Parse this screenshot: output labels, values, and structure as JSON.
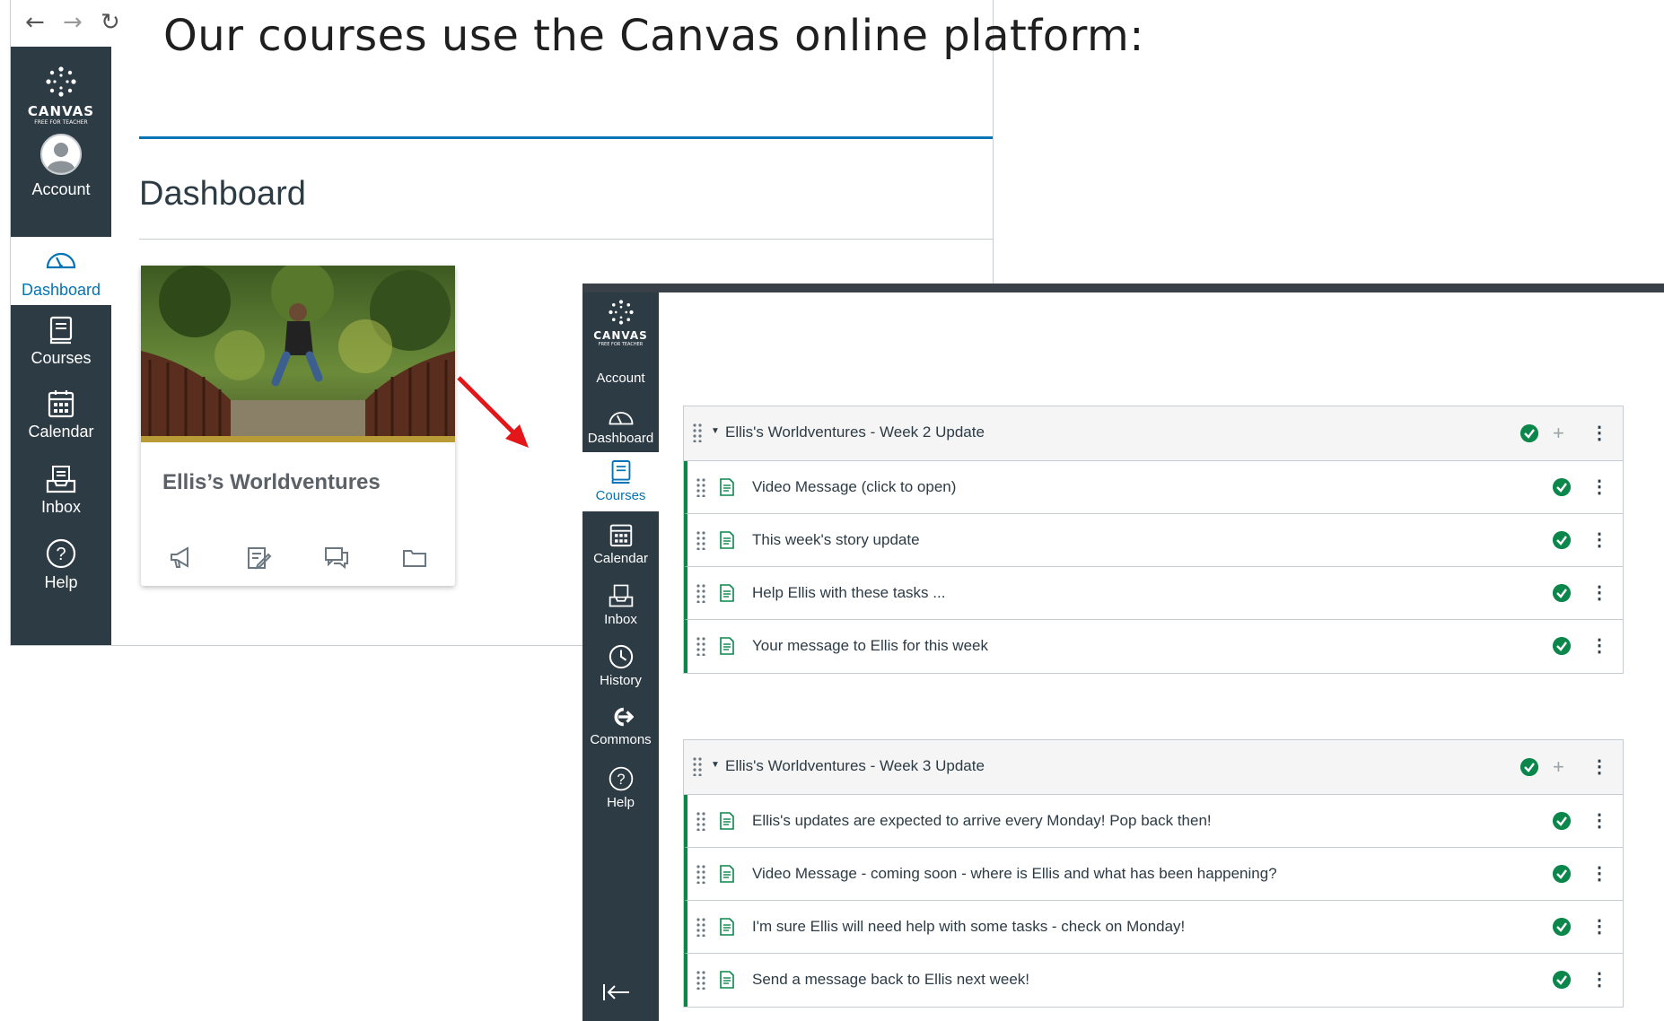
{
  "headline": "Our courses use the Canvas online platform:",
  "browser": {
    "back_icon": "←",
    "forward_icon": "→",
    "reload_icon": "↻"
  },
  "canvas_logo": {
    "text": "CANVAS",
    "sub": "FREE FOR TEACHER"
  },
  "left_nav": {
    "account": "Account",
    "dashboard": "Dashboard",
    "courses": "Courses",
    "calendar": "Calendar",
    "inbox": "Inbox",
    "help": "Help"
  },
  "dashboard": {
    "title": "Dashboard"
  },
  "course_card": {
    "title": "Ellis’s Worldventures"
  },
  "right_nav": {
    "account": "Account",
    "dashboard": "Dashboard",
    "courses": "Courses",
    "calendar": "Calendar",
    "inbox": "Inbox",
    "history": "History",
    "commons": "Commons",
    "help": "Help"
  },
  "modules": [
    {
      "title": "Ellis's Worldventures - Week 2 Update",
      "items": [
        "Video Message (click to open)",
        "This week's story update",
        "Help Ellis with these tasks ...",
        "Your message to Ellis for this week"
      ]
    },
    {
      "title": "Ellis's Worldventures - Week 3 Update",
      "items": [
        "Ellis's updates are expected to arrive every Monday! Pop back then!",
        "Video Message - coming soon - where is Ellis and what has been happening?",
        "I'm sure Ellis will need help with some tasks - check on Monday!",
        "Send a message back to Ellis next week!"
      ]
    }
  ],
  "colors": {
    "nav_bg": "#2d3b45",
    "brand_blue": "#0374b5",
    "success_green": "#0b874b",
    "arrow_red": "#e3171a"
  }
}
